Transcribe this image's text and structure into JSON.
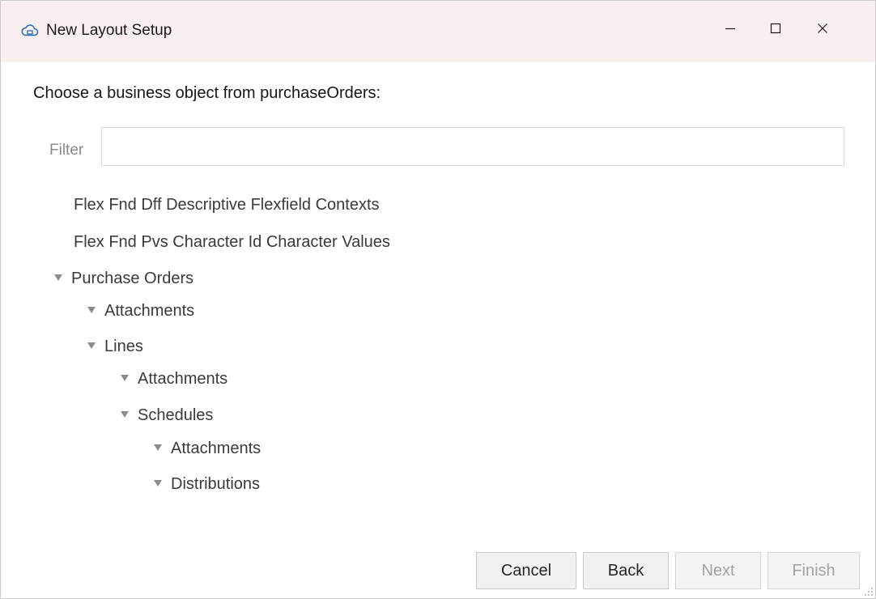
{
  "window": {
    "title": "New Layout Setup",
    "icon": "cloud-icon",
    "controls": {
      "minimize": "minimize-icon",
      "maximize": "maximize-icon",
      "close": "close-icon"
    }
  },
  "prompt": "Choose a business object from purchaseOrders:",
  "filter": {
    "label": "Filter",
    "value": "",
    "placeholder": ""
  },
  "tree": {
    "item0": "Flex Fnd Dff Descriptive Flexfield Contexts",
    "item1": "Flex Fnd Pvs Character Id Character Values",
    "item2": "Purchase Orders",
    "item3": "Attachments",
    "item4": "Lines",
    "item5": "Attachments",
    "item6": "Schedules",
    "item7": "Attachments",
    "item8": "Distributions"
  },
  "buttons": {
    "cancel": "Cancel",
    "back": "Back",
    "next": "Next",
    "finish": "Finish"
  },
  "button_states": {
    "next": "disabled",
    "finish": "disabled"
  }
}
